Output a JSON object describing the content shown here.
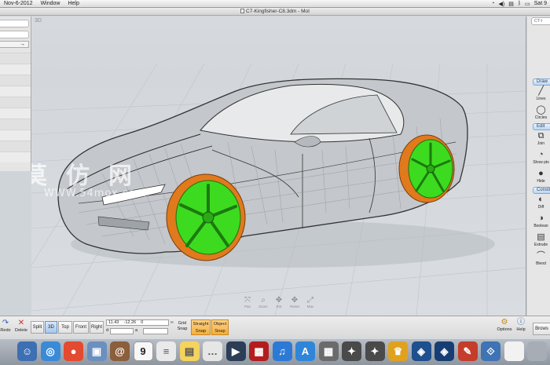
{
  "menubar": {
    "left_items": [
      "Nov-6-2012",
      "Window",
      "Help"
    ],
    "clock": "Sat 9"
  },
  "window": {
    "title": "C7-Kingfisher-C8.3dm - MoI",
    "right_label": "CT-"
  },
  "viewport": {
    "label": "3D",
    "nav_tools": [
      {
        "name": "pan-tool",
        "glyph": "⤧",
        "label": "Pan"
      },
      {
        "name": "zoom-tool",
        "glyph": "⌕",
        "label": "Zoom"
      },
      {
        "name": "rotate-tool",
        "glyph": "✥",
        "label": "Rot"
      },
      {
        "name": "reset-tool",
        "glyph": "✥",
        "label": "Reset"
      },
      {
        "name": "max-tool",
        "glyph": "⤢",
        "label": "Max"
      }
    ],
    "watermark_line1": "莫仿网",
    "watermark_line2": "WWW.54mox.com"
  },
  "right_panel": {
    "top_field": "CT-I",
    "sections": [
      {
        "header": "Draw",
        "tools": [
          {
            "name": "lines",
            "glyph": "╱",
            "label": "Lines"
          },
          {
            "name": "circles",
            "glyph": "◯",
            "label": "Circles"
          }
        ]
      },
      {
        "header": "Edit",
        "tools": [
          {
            "name": "join",
            "glyph": "⧉",
            "label": "Join"
          },
          {
            "name": "show-pts",
            "glyph": "◔",
            "label": "Show pts"
          },
          {
            "name": "hide",
            "glyph": "●",
            "label": "Hide"
          }
        ]
      },
      {
        "header": "Constr",
        "tools": [
          {
            "name": "diff",
            "glyph": "◐",
            "label": "Diff"
          },
          {
            "name": "boolean",
            "glyph": "◑",
            "label": "Boolean"
          },
          {
            "name": "extrude",
            "glyph": "▤",
            "label": "Extrude"
          },
          {
            "name": "blend",
            "glyph": "⌒",
            "label": "Blend"
          }
        ]
      }
    ]
  },
  "bottombar": {
    "redo": "Redo",
    "delete": "Delete",
    "views": [
      "Split",
      "3D",
      "Top",
      "Front",
      "Right"
    ],
    "active_view": "3D",
    "coords": {
      "x": "11.43",
      "y": "-12.26",
      "z": "0",
      "d_label": "d",
      "a_label": "a",
      "d_value": "",
      "a_value": ""
    },
    "grid_snap": "Grid Snap",
    "straight_snap": "Straight Snap",
    "object_snap": "Object Snap",
    "options": "Options",
    "help": "Help",
    "browse": "Brows"
  },
  "dock": {
    "calendar_day": "9",
    "apps": [
      {
        "name": "finder",
        "color": "#3d6fb3",
        "glyph": "☺"
      },
      {
        "name": "safari",
        "color": "#3a8ad8",
        "glyph": "◎"
      },
      {
        "name": "chrome",
        "color": "#e34a2f",
        "glyph": "●"
      },
      {
        "name": "preview",
        "color": "#6b8fbf",
        "glyph": "▣"
      },
      {
        "name": "address-book",
        "color": "#8b5e3c",
        "glyph": "@"
      },
      {
        "name": "calendar",
        "color": "#f7f7f7",
        "glyph": ""
      },
      {
        "name": "textedit",
        "color": "#e9e9e9",
        "glyph": "≡"
      },
      {
        "name": "stickies",
        "color": "#f4d35e",
        "glyph": "▤"
      },
      {
        "name": "messages",
        "color": "#e6e6e6",
        "glyph": "…"
      },
      {
        "name": "quicktime",
        "color": "#2c3e56",
        "glyph": "▶"
      },
      {
        "name": "photo-booth",
        "color": "#b31d1d",
        "glyph": "▩"
      },
      {
        "name": "itunes",
        "color": "#2d7ad6",
        "glyph": "♫"
      },
      {
        "name": "app-store",
        "color": "#2f86d9",
        "glyph": "A"
      },
      {
        "name": "photo-app",
        "color": "#6b6b6b",
        "glyph": "▦"
      },
      {
        "name": "bulb-app",
        "color": "#4a4a4a",
        "glyph": "✦"
      },
      {
        "name": "bulb-app-2",
        "color": "#4a4a4a",
        "glyph": "✦"
      },
      {
        "name": "lion-app",
        "color": "#e0a21e",
        "glyph": "♛"
      },
      {
        "name": "moi-app",
        "color": "#1e4f8e",
        "glyph": "◈"
      },
      {
        "name": "moi-app-2",
        "color": "#173e74",
        "glyph": "◈"
      },
      {
        "name": "pen-app",
        "color": "#c53c2b",
        "glyph": "✎"
      },
      {
        "name": "utility-app",
        "color": "#3e73b5",
        "glyph": "⟐"
      },
      {
        "name": "document",
        "color": "#f2f2f2",
        "glyph": ""
      },
      {
        "name": "trash",
        "color": "#a7adb4",
        "glyph": ""
      }
    ]
  }
}
